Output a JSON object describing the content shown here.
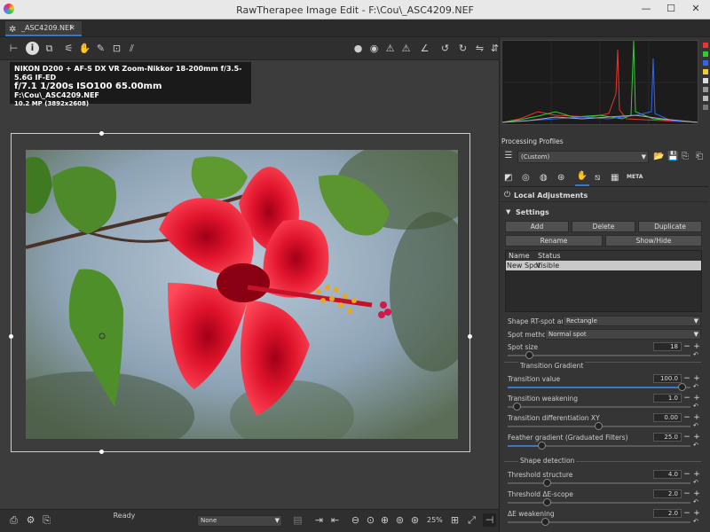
{
  "window": {
    "title": "RawTherapee Image Edit - F:\\Cou\\_ASC4209.NEF",
    "min": "—",
    "max": "☐",
    "close": "✕"
  },
  "tab": {
    "label": "_ASC4209.NEF",
    "close": "✕"
  },
  "exif": {
    "line1": "NIKON D200 + AF-S DX VR Zoom-Nikkor 18-200mm f/3.5-5.6G IF-ED",
    "line2_f": "f/7.1",
    "line2_shutter": "1/200s",
    "line2_iso": "ISO100",
    "line2_focal": "65.00mm",
    "line3": "F:\\Cou\\_ASC4209.NEF",
    "line4": "10.2 MP (3892x2608)"
  },
  "status": {
    "ready": "Ready",
    "profile_select": "None",
    "zoom": "25%"
  },
  "processing_profiles": {
    "label": "Processing Profiles",
    "value": "(Custom)"
  },
  "local_adjustments": {
    "title": "Local Adjustments",
    "settings_label": "Settings",
    "buttons": {
      "add": "Add",
      "delete": "Delete",
      "duplicate": "Duplicate",
      "rename": "Rename",
      "showhide": "Show/Hide"
    },
    "table": {
      "col_name": "Name",
      "col_status": "Status",
      "row_name": "New Spot",
      "row_status": "Visible"
    },
    "shape_label": "Shape RT-spot area:",
    "shape_value": "Rectangle",
    "method_label": "Spot method:",
    "method_value": "Normal spot",
    "spot_size_label": "Spot size",
    "spot_size_value": "18",
    "transition_gradient": "Transition Gradient",
    "transition_value_label": "Transition value",
    "transition_value": "100.0",
    "transition_weak_label": "Transition weakening",
    "transition_weak": "1.0",
    "transition_diff_label": "Transition differentiation XY",
    "transition_diff": "0.00",
    "feather_label": "Feather gradient (Graduated Filters)",
    "feather": "25.0",
    "shape_detection": "Shape detection",
    "threshold_label": "Threshold structure",
    "threshold": "4.0",
    "scope_label": "Threshold ΔE-scope",
    "scope": "2.0",
    "weak_label": "ΔE weakening",
    "weak": "2.0"
  },
  "colors": {
    "accent": "#3a78c2",
    "panel": "#353535",
    "viewer": "#3c3c3c"
  }
}
